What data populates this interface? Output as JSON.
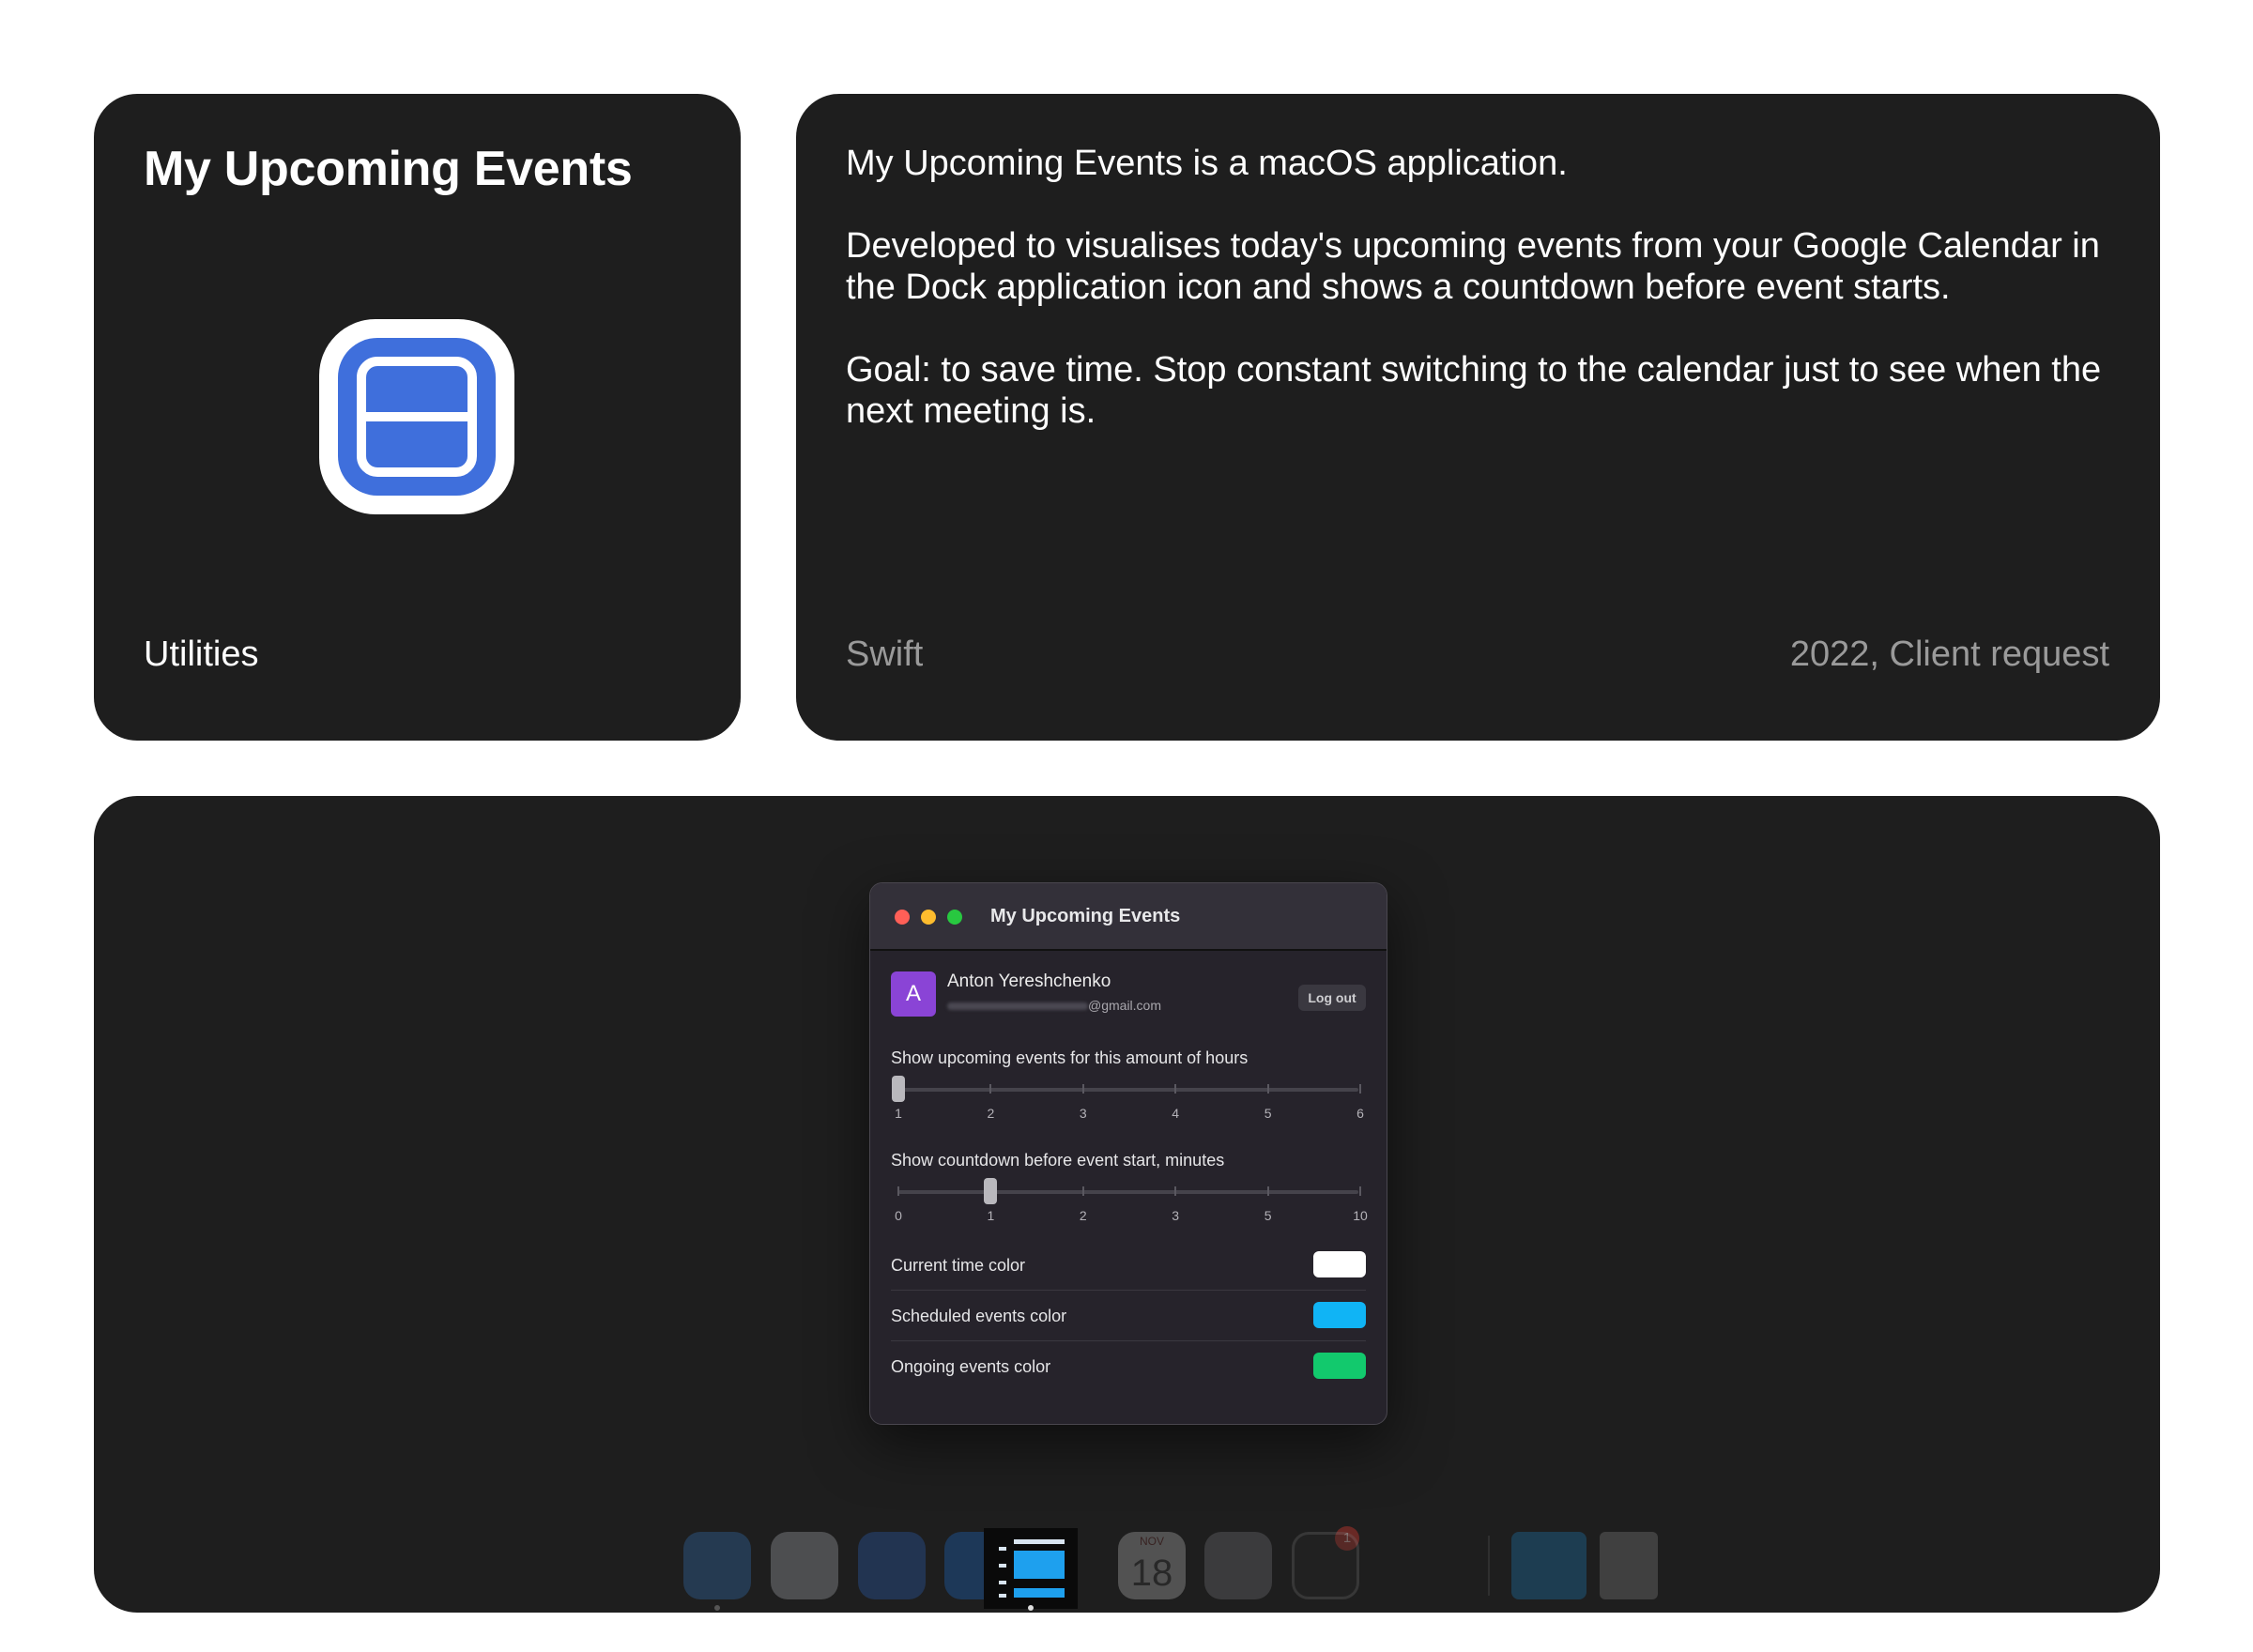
{
  "project": {
    "title": "My Upcoming Events",
    "category": "Utilities",
    "description": [
      "My Upcoming Events is a macOS application.",
      "Developed to visualises today's upcoming events from your Google Calendar in the Dock application icon and shows a countdown before event starts.",
      "Goal: to save time. Stop constant switching to the calendar just to see when the next meeting is."
    ],
    "tech": "Swift",
    "year_context": "2022, Client request",
    "icon": "app-icon-calendar-bars"
  },
  "window": {
    "title": "My Upcoming Events",
    "user": {
      "avatar_letter": "A",
      "name": "Anton Yereshchenko",
      "email_suffix": "@gmail.com",
      "logout_label": "Log out"
    },
    "hours_slider": {
      "label": "Show upcoming events for this amount of hours",
      "ticks": [
        "1",
        "2",
        "3",
        "4",
        "5",
        "6"
      ],
      "selected_index": 0
    },
    "countdown_slider": {
      "label": "Show countdown before event start, minutes",
      "ticks": [
        "0",
        "1",
        "2",
        "3",
        "5",
        "10"
      ],
      "selected_index": 1
    },
    "colors": [
      {
        "label": "Current time color",
        "value": "#ffffff"
      },
      {
        "label": "Scheduled events color",
        "value": "#10b4f5"
      },
      {
        "label": "Ongoing events color",
        "value": "#12c96d"
      }
    ]
  },
  "dock": {
    "calendar_month": "NOV",
    "calendar_day": "18",
    "settings_badge": "1",
    "icons": [
      "finder-icon",
      "safari-icon",
      "xcode-icon",
      "app-store-icon",
      "my-upcoming-events-icon",
      "calendar-icon",
      "system-settings-icon",
      "terminal-icon",
      "downloads-folder-icon",
      "trash-icon"
    ]
  }
}
